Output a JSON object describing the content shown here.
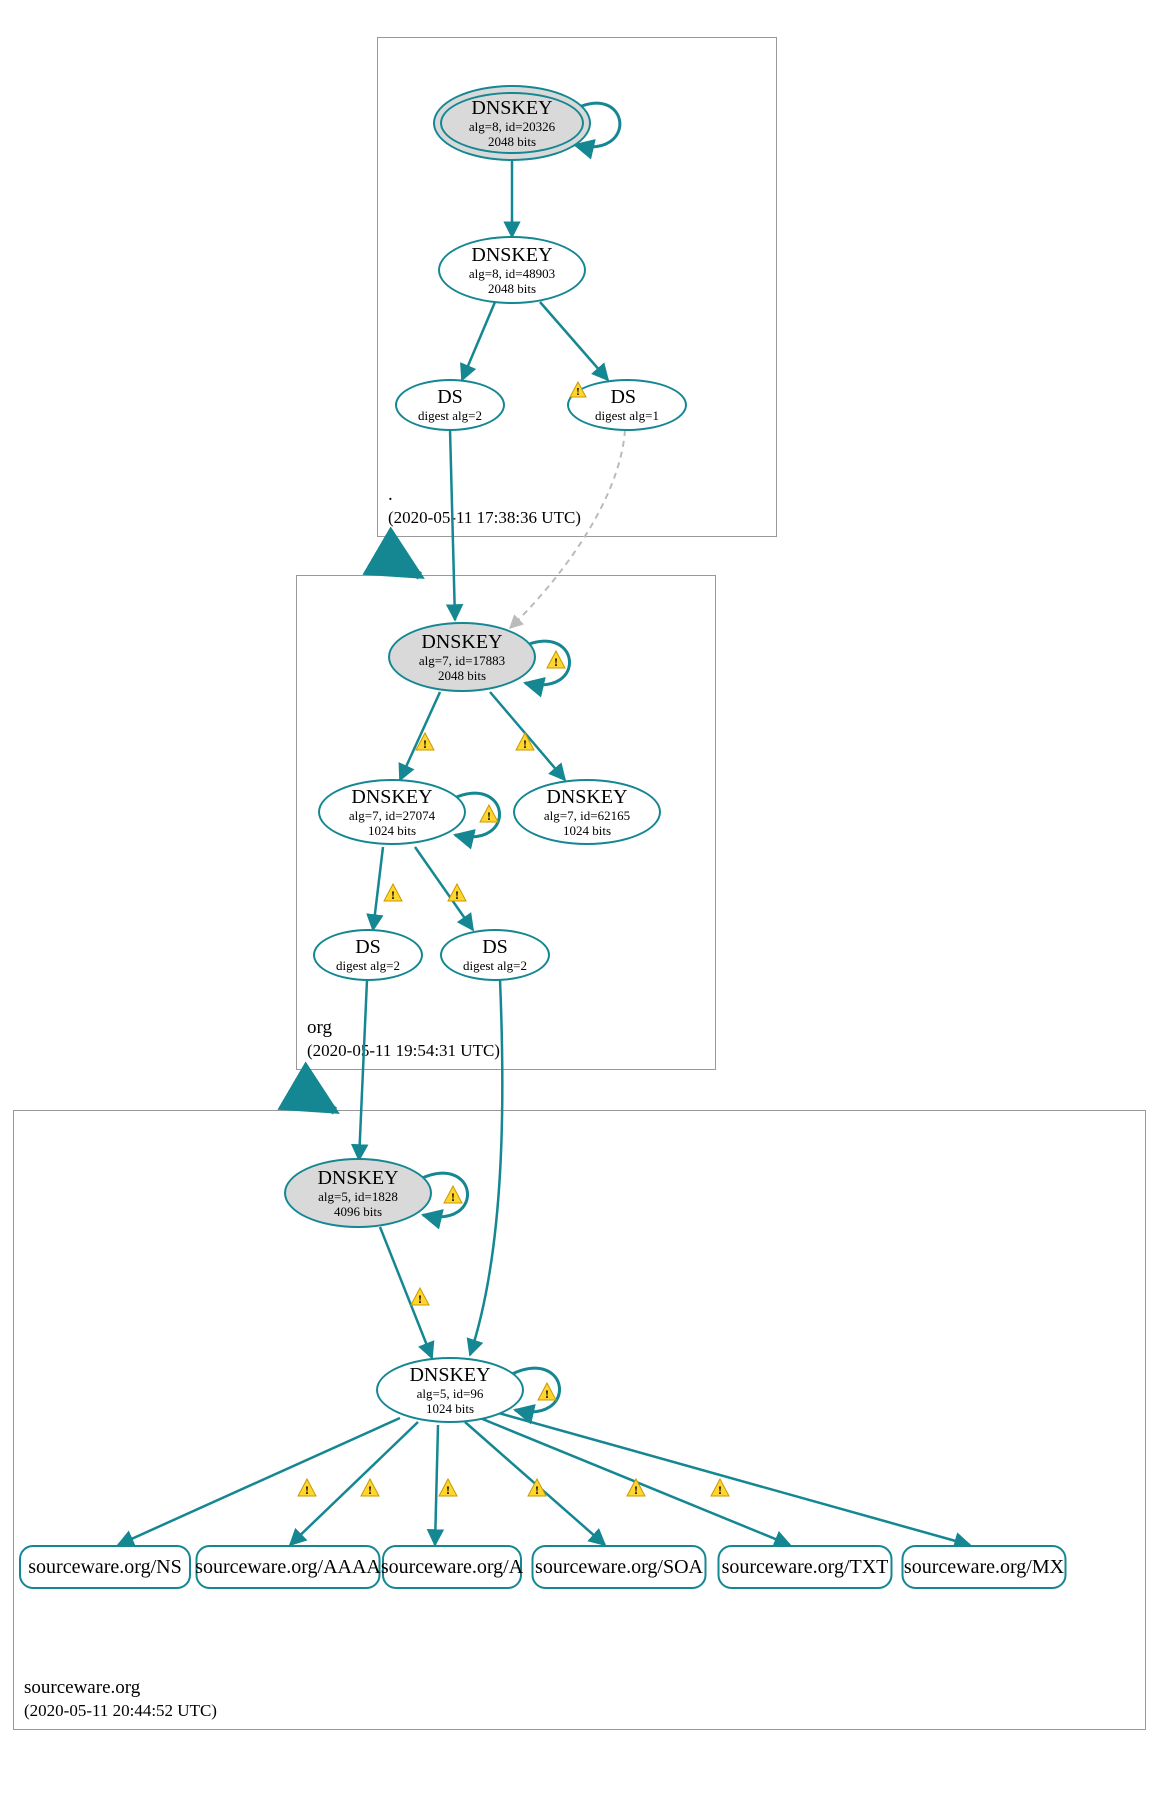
{
  "zones": {
    "root": {
      "name": ".",
      "timestamp": "(2020-05-11 17:38:36 UTC)"
    },
    "org": {
      "name": "org",
      "timestamp": "(2020-05-11 19:54:31 UTC)"
    },
    "sourceware": {
      "name": "sourceware.org",
      "timestamp": "(2020-05-11 20:44:52 UTC)"
    }
  },
  "nodes": {
    "root_ksk": {
      "title": "DNSKEY",
      "line2": "alg=8, id=20326",
      "line3": "2048 bits"
    },
    "root_zsk": {
      "title": "DNSKEY",
      "line2": "alg=8, id=48903",
      "line3": "2048 bits"
    },
    "root_ds2": {
      "title": "DS",
      "line2": "digest alg=2"
    },
    "root_ds1": {
      "title": "DS",
      "line2": "digest alg=1"
    },
    "org_ksk": {
      "title": "DNSKEY",
      "line2": "alg=7, id=17883",
      "line3": "2048 bits"
    },
    "org_zsk": {
      "title": "DNSKEY",
      "line2": "alg=7, id=27074",
      "line3": "1024 bits"
    },
    "org_zsk2": {
      "title": "DNSKEY",
      "line2": "alg=7, id=62165",
      "line3": "1024 bits"
    },
    "org_ds_a": {
      "title": "DS",
      "line2": "digest alg=2"
    },
    "org_ds_b": {
      "title": "DS",
      "line2": "digest alg=2"
    },
    "sw_ksk": {
      "title": "DNSKEY",
      "line2": "alg=5, id=1828",
      "line3": "4096 bits"
    },
    "sw_zsk": {
      "title": "DNSKEY",
      "line2": "alg=5, id=96",
      "line3": "1024 bits"
    }
  },
  "records": {
    "ns": "sourceware.org/NS",
    "aaaa": "sourceware.org/AAAA",
    "a": "sourceware.org/A",
    "soa": "sourceware.org/SOA",
    "txt": "sourceware.org/TXT",
    "mx": "sourceware.org/MX"
  }
}
